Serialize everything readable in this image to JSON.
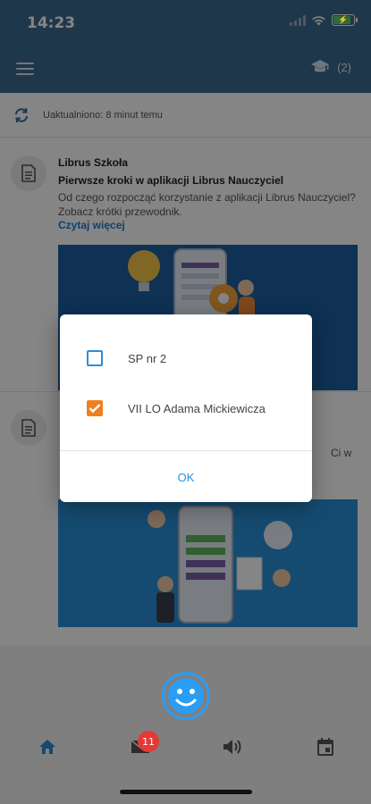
{
  "status_bar": {
    "time": "14:23"
  },
  "header": {
    "classes_count": "(2)"
  },
  "refresh": {
    "text": "Uaktualniono: 8 minut temu"
  },
  "news": [
    {
      "source": "Librus Szkoła",
      "title": "Pierwsze kroki w aplikacji Librus Nauczyciel",
      "body": "Od czego rozpocząć korzystanie z aplikacji Librus Nauczyciel? Zobacz krótki przewodnik.",
      "more": "Czytaj więcej"
    },
    {
      "source": "",
      "title": "",
      "body_tail": "Ci w",
      "more": ""
    }
  ],
  "dialog": {
    "options": [
      {
        "label": "SP nr 2",
        "checked": false
      },
      {
        "label": "VII LO Adama Mickiewicza",
        "checked": true
      }
    ],
    "ok_label": "OK"
  },
  "tabbar": {
    "messages_badge": "11"
  },
  "colors": {
    "header": "#3d6a8f",
    "accent": "#2a9df4",
    "checked": "#f07f1e",
    "badge": "#e53935",
    "link": "#1a7bd6"
  }
}
